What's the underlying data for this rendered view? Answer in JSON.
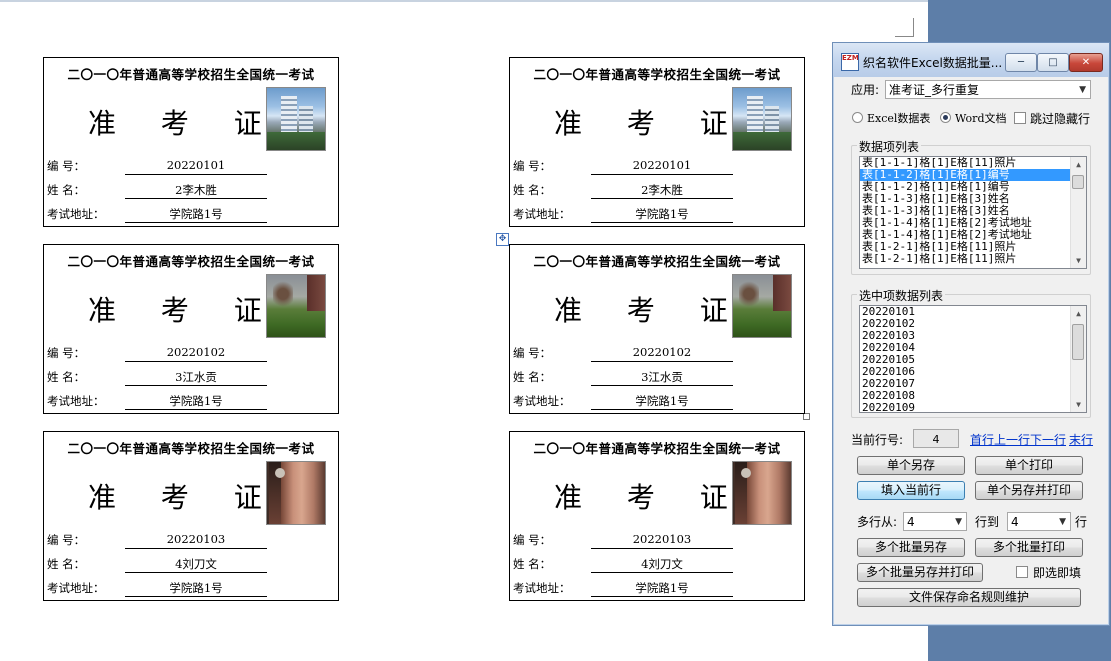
{
  "cards": [
    {
      "title": "二〇一〇年普通高等学校招生全国统一考试",
      "heading": "准 考 证",
      "labels": {
        "number": "编    号：",
        "name": "姓    名：",
        "address": "考试地址："
      },
      "number": "20220101",
      "name": "2李木胜",
      "address": "学院路1号",
      "photo": "building"
    },
    {
      "title": "二〇一〇年普通高等学校招生全国统一考试",
      "heading": "准 考 证",
      "labels": {
        "number": "编    号：",
        "name": "姓    名：",
        "address": "考试地址："
      },
      "number": "20220102",
      "name": "3江水贡",
      "address": "学院路1号",
      "photo": "grass"
    },
    {
      "title": "二〇一〇年普通高等学校招生全国统一考试",
      "heading": "准 考 证",
      "labels": {
        "number": "编    号：",
        "name": "姓    名：",
        "address": "考试地址："
      },
      "number": "20220103",
      "name": "4刘刀文",
      "address": "学院路1号",
      "photo": "hand"
    },
    {
      "title": "二〇一〇年普通高等学校招生全国统一考试",
      "heading": "准 考 证",
      "labels": {
        "number": "编    号：",
        "name": "姓    名：",
        "address": "考试地址："
      },
      "number": "20220101",
      "name": "2李木胜",
      "address": "学院路1号",
      "photo": "building"
    },
    {
      "title": "二〇一〇年普通高等学校招生全国统一考试",
      "heading": "准 考 证",
      "labels": {
        "number": "编    号：",
        "name": "姓    名：",
        "address": "考试地址："
      },
      "number": "20220102",
      "name": "3江水贡",
      "address": "学院路1号",
      "photo": "grass"
    },
    {
      "title": "二〇一〇年普通高等学校招生全国统一考试",
      "heading": "准 考 证",
      "labels": {
        "number": "编    号：",
        "name": "姓    名：",
        "address": "考试地址："
      },
      "number": "20220103",
      "name": "4刘刀文",
      "address": "学院路1号",
      "photo": "hand"
    }
  ],
  "dialog": {
    "title": "织名软件Excel数据批量...",
    "icon_text": "EZM",
    "window_buttons": {
      "minimize": "─",
      "maximize": "□",
      "close": "✕"
    },
    "app_label": "应用:",
    "app_value": "准考证_多行重复",
    "radio_excel": "Excel数据表",
    "radio_word": "Word文档",
    "skip_hidden": "跳过隐藏行",
    "data_items_title": "数据项列表",
    "data_items": [
      "表[1-1-1]格[1]E格[11]照片",
      "表[1-1-2]格[1]E格[1]编号",
      "表[1-1-2]格[1]E格[1]编号",
      "表[1-1-3]格[1]E格[3]姓名",
      "表[1-1-3]格[1]E格[3]姓名",
      "表[1-1-4]格[1]E格[2]考试地址",
      "表[1-1-4]格[1]E格[2]考试地址",
      "表[1-2-1]格[1]E格[11]照片",
      "表[1-2-1]格[1]E格[11]照片"
    ],
    "selected_items_title": "选中项数据列表",
    "selected_items": [
      "20220101",
      "20220102",
      "20220103",
      "20220104",
      "20220105",
      "20220106",
      "20220107",
      "20220108",
      "20220109"
    ],
    "current_row_label": "当前行号:",
    "current_row": "4",
    "nav": {
      "first": "首行",
      "prev": "上一行",
      "next": "下一行",
      "last": "末行"
    },
    "buttons": {
      "single_save": "单个另存",
      "single_print": "单个打印",
      "fill_current": "填入当前行",
      "single_save_print": "单个另存并打印",
      "multi_save": "多个批量另存",
      "multi_print": "多个批量打印",
      "multi_save_print": "多个批量另存并打印",
      "naming_rules": "文件保存命名规则维护"
    },
    "multi_from_label": "多行从:",
    "multi_from": "4",
    "multi_to_label": "行到",
    "multi_to": "4",
    "multi_row_suffix": "行",
    "instant_fill": "即选即填"
  }
}
